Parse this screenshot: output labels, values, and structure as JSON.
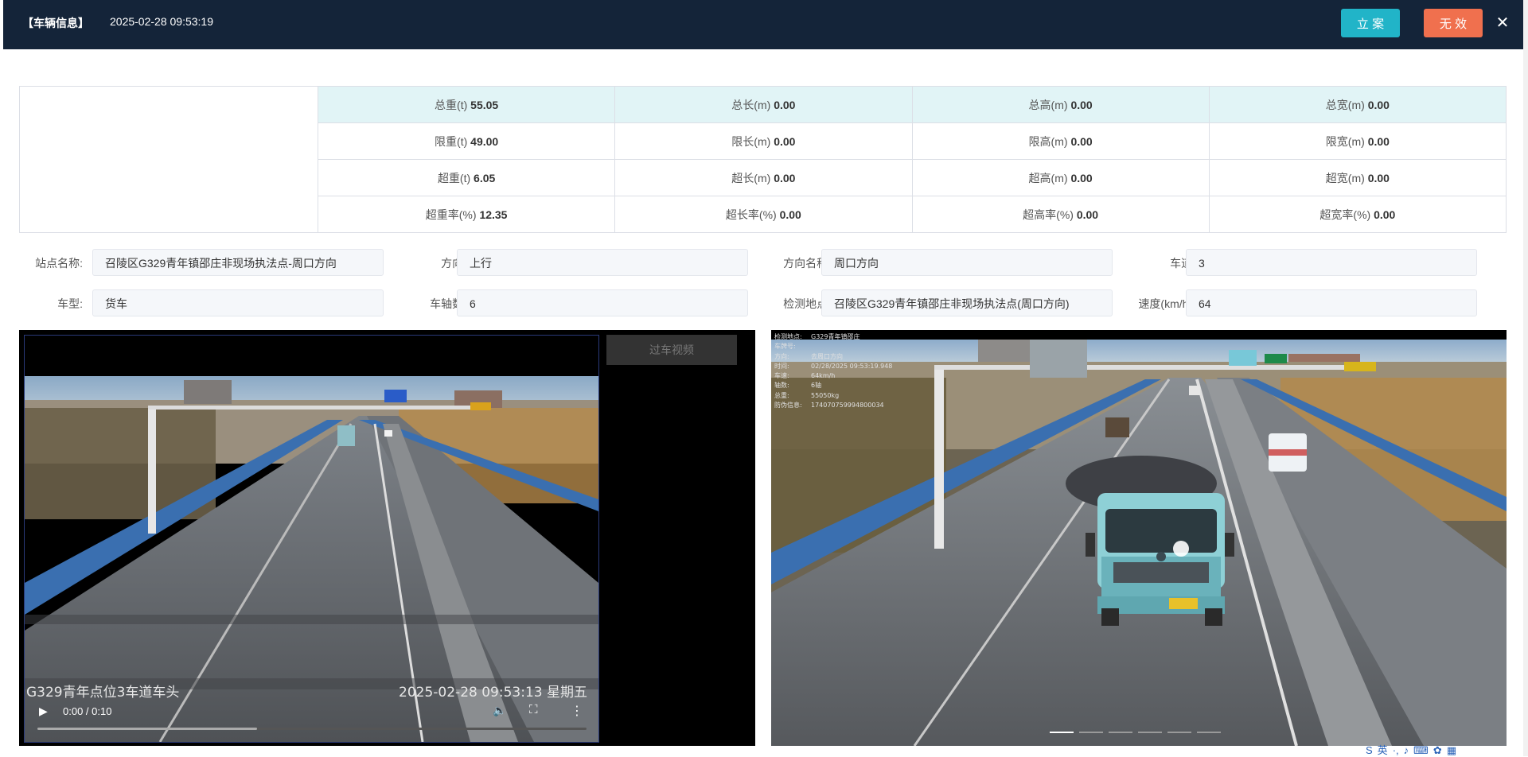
{
  "header": {
    "title": "【车辆信息】",
    "datetime": "2025-02-28 09:53:19",
    "file_button": "立 案",
    "invalid_button": "无 效",
    "close_icon": "close-icon",
    "colors": {
      "bg": "#142439",
      "file": "#21b4c8",
      "invalid": "#f0704e"
    }
  },
  "measure": {
    "rows": [
      [
        {
          "label": "总重(t)",
          "value": "55.05"
        },
        {
          "label": "总长(m)",
          "value": "0.00"
        },
        {
          "label": "总高(m)",
          "value": "0.00"
        },
        {
          "label": "总宽(m)",
          "value": "0.00"
        }
      ],
      [
        {
          "label": "限重(t)",
          "value": "49.00"
        },
        {
          "label": "限长(m)",
          "value": "0.00"
        },
        {
          "label": "限高(m)",
          "value": "0.00"
        },
        {
          "label": "限宽(m)",
          "value": "0.00"
        }
      ],
      [
        {
          "label": "超重(t)",
          "value": "6.05"
        },
        {
          "label": "超长(m)",
          "value": "0.00"
        },
        {
          "label": "超高(m)",
          "value": "0.00"
        },
        {
          "label": "超宽(m)",
          "value": "0.00"
        }
      ],
      [
        {
          "label": "超重率(%)",
          "value": "12.35"
        },
        {
          "label": "超长率(%)",
          "value": "0.00"
        },
        {
          "label": "超高率(%)",
          "value": "0.00"
        },
        {
          "label": "超宽率(%)",
          "value": "0.00"
        }
      ]
    ]
  },
  "fields": {
    "station_label": "站点名称:",
    "station": "召陵区G329青年镇邵庄非现场执法点-周口方向",
    "direction_label": "方向:",
    "direction": "上行",
    "direction_name_label": "方向名称:",
    "direction_name": "周口方向",
    "lane_label": "车道:",
    "lane": "3",
    "vehicle_type_label": "车型:",
    "vehicle_type": "货车",
    "axle_label": "车轴数:",
    "axle": "6",
    "location_label": "检测地点:",
    "location": "召陵区G329青年镇邵庄非现场执法点(周口方向)",
    "speed_label": "速度(km/h):",
    "speed": "64"
  },
  "video": {
    "caption_left": "G329青年点位3车道车头",
    "caption_right": "2025-02-28 09:53:13 星期五",
    "time": "0:00 / 0:10",
    "progress": 0.4,
    "pass_video_button": "过车视频"
  },
  "image": {
    "osd": [
      {
        "k": "检测地点:",
        "v": "G329青年镇邵庄"
      },
      {
        "k": "车牌号:",
        "v": ""
      },
      {
        "k": "方向:",
        "v": "去周口方向"
      },
      {
        "k": "时间:",
        "v": "02/28/2025 09:53:19.948"
      },
      {
        "k": "车速:",
        "v": "64km/h"
      },
      {
        "k": "轴数:",
        "v": "6轴"
      },
      {
        "k": "总重:",
        "v": "55050kg"
      },
      {
        "k": "防伪信息:",
        "v": "174070759994800034"
      }
    ],
    "carousel_count": 6,
    "carousel_active": 0
  }
}
